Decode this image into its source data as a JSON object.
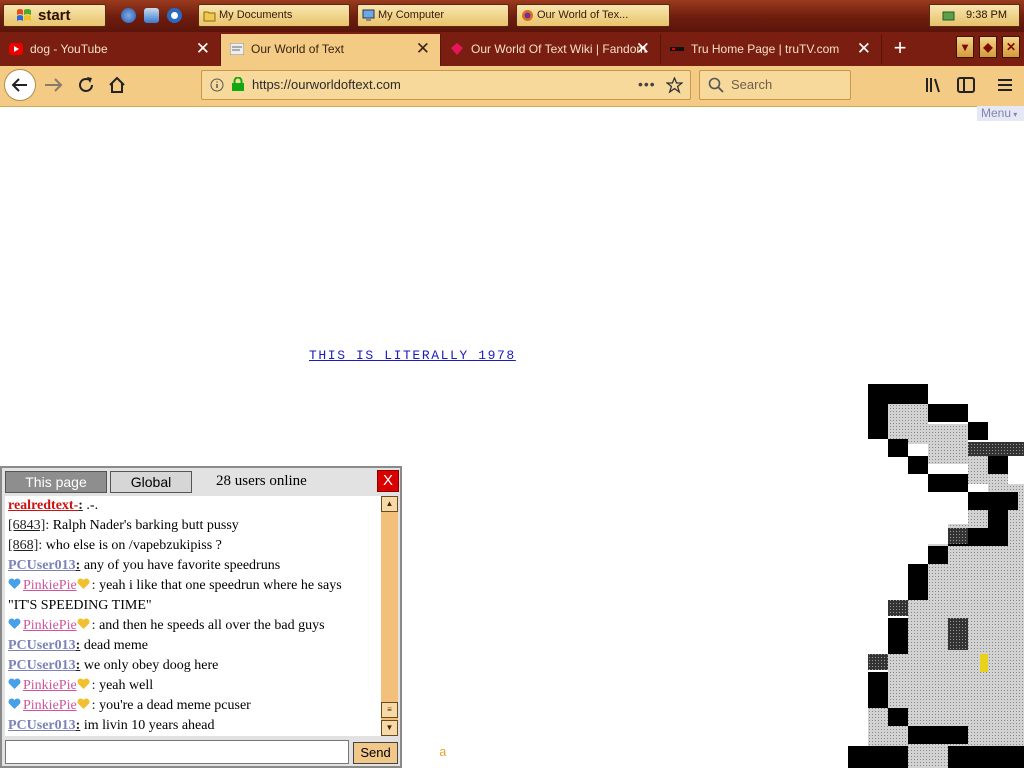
{
  "taskbar": {
    "start_label": "start",
    "windows": [
      {
        "label": "My Documents",
        "icon": "folder-icon"
      },
      {
        "label": "My Computer",
        "icon": "computer-icon"
      },
      {
        "label": "Our World of Tex...",
        "icon": "firefox-icon"
      }
    ],
    "quick_launch": [
      "ie-icon",
      "outlook-icon",
      "media-player-icon"
    ],
    "clock": "9:38 PM"
  },
  "browser": {
    "tabs": [
      {
        "title": "dog - YouTube",
        "icon": "youtube-icon",
        "active": false
      },
      {
        "title": "Our World of Text",
        "icon": "owot-icon",
        "active": true
      },
      {
        "title": "Our World Of Text Wiki | Fandom",
        "icon": "fandom-icon",
        "active": false
      },
      {
        "title": "Tru Home Page | truTV.com",
        "icon": "trutv-icon",
        "active": false
      }
    ],
    "url": "https://ourworldoftext.com",
    "search_placeholder": "Search"
  },
  "page": {
    "menu_label": "Menu",
    "link_text": "THIS IS LITERALLY 1978",
    "stray_char": "a"
  },
  "chat": {
    "tab_this_page": "This page",
    "tab_global": "Global",
    "users_online": "28 users online",
    "close_label": "X",
    "send_label": "Send",
    "messages": [
      {
        "nick": "realredtext-",
        "style": "red",
        "text": ".-."
      },
      {
        "nick": "[6843]",
        "style": "anon",
        "text": "Ralph Nader's barking butt pussy"
      },
      {
        "nick": "[868]",
        "style": "anon",
        "text": "who else is on /vapebzukipiss ?"
      },
      {
        "nick": "PCUser013",
        "style": "pc",
        "text": "any of you have favorite speedruns"
      },
      {
        "nick": "PinkiePie",
        "style": "pink",
        "text": "yeah i like that one speedrun where he says",
        "cont": "\"IT'S SPEEDING TIME\""
      },
      {
        "nick": "PinkiePie",
        "style": "pink",
        "text": "and then he speeds all over the bad guys"
      },
      {
        "nick": "PCUser013",
        "style": "pc",
        "text": "dead meme"
      },
      {
        "nick": "PCUser013",
        "style": "pc",
        "text": "we only obey doog here"
      },
      {
        "nick": "PinkiePie",
        "style": "pink",
        "text": "yeah well"
      },
      {
        "nick": "PinkiePie",
        "style": "pink",
        "text": "you're a dead meme pcuser"
      },
      {
        "nick": "PCUser013",
        "style": "pc",
        "text": "im livin 10 years ahead"
      }
    ]
  },
  "colors": {
    "taskbar": "#7a1e12",
    "tab_active": "#f3cb84",
    "link": "#1b1bbf",
    "chat_close": "#d80000"
  }
}
